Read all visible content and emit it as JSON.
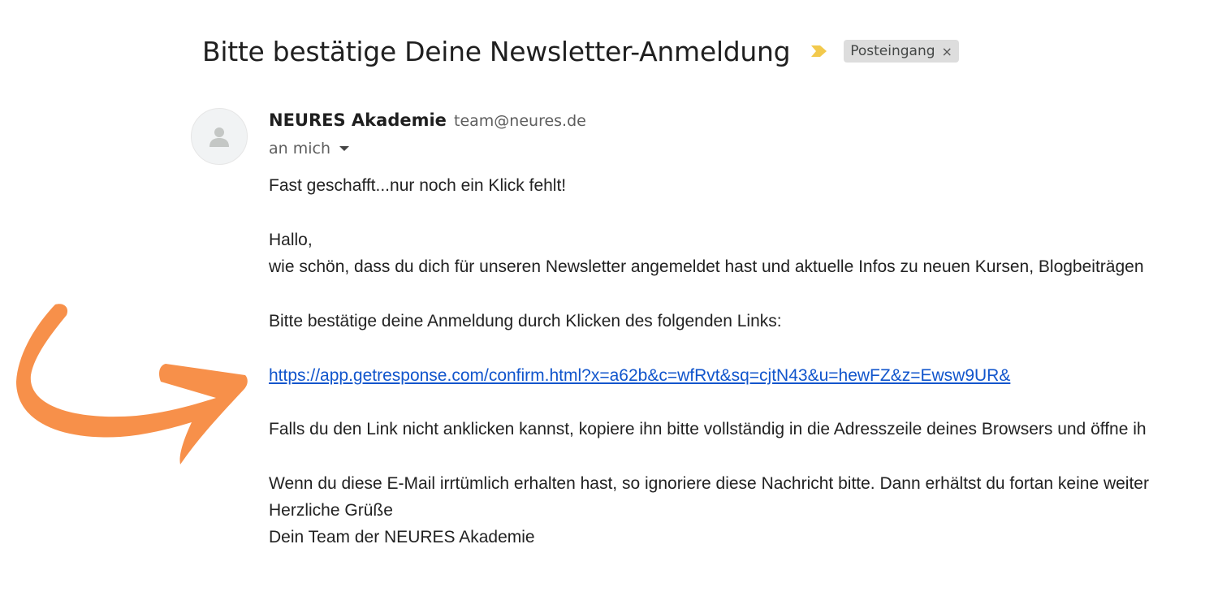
{
  "email": {
    "subject": "Bitte bestätige Deine Newsletter-Anmeldung",
    "label": "Posteingang",
    "label_remove": "×",
    "sender_name": "NEURES Akademie",
    "sender_email": "team@neures.de",
    "recipient": "an mich",
    "body": {
      "intro": "Fast geschafft...nur noch ein Klick fehlt!",
      "greeting": "Hallo,",
      "line1": "wie schön, dass du dich für unseren Newsletter angemeldet hast und aktuelle Infos zu neuen Kursen, Blogbeiträgen",
      "instruction": "Bitte bestätige deine Anmeldung durch Klicken des folgenden Links:",
      "confirm_link": "https://app.getresponse.com/confirm.html?x=a62b&c=wfRvt&sq=cjtN43&u=hewFZ&z=Ewsw9UR&",
      "fallback": "Falls du den Link nicht anklicken kannst, kopiere ihn bitte vollständig in die Adresszeile deines Browsers und öffne ih",
      "mistake": "Wenn du diese E-Mail irrtümlich erhalten hast, so ignoriere diese Nachricht bitte. Dann erhältst du fortan keine weiter",
      "closing": "Herzliche Grüße",
      "signature": "Dein Team der NEURES Akademie"
    }
  },
  "colors": {
    "link": "#1155cc",
    "importance_marker": "#f2c94c",
    "arrow": "#f7904a",
    "label_chip_bg": "#dddddd"
  },
  "icons": {
    "importance": "importance-marker-icon",
    "avatar": "person-icon",
    "recipient_details": "caret-down-icon",
    "pointer": "curved-arrow-icon"
  }
}
